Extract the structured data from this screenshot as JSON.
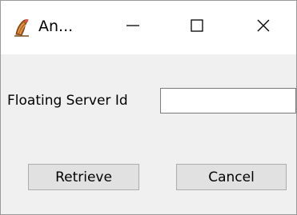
{
  "window": {
    "title": "An...",
    "app_icon": "java-duke-icon",
    "controls": {
      "minimize_icon": "minimize-icon",
      "maximize_icon": "maximize-icon",
      "close_icon": "close-icon"
    }
  },
  "form": {
    "field_label": "Floating Server Id",
    "field_value": "",
    "retrieve_label": "Retrieve",
    "cancel_label": "Cancel"
  },
  "colors": {
    "titlebar": "#ffffff",
    "client_background": "#f0f0f0",
    "button_face": "#e1e1e1",
    "button_border": "#adadad"
  }
}
